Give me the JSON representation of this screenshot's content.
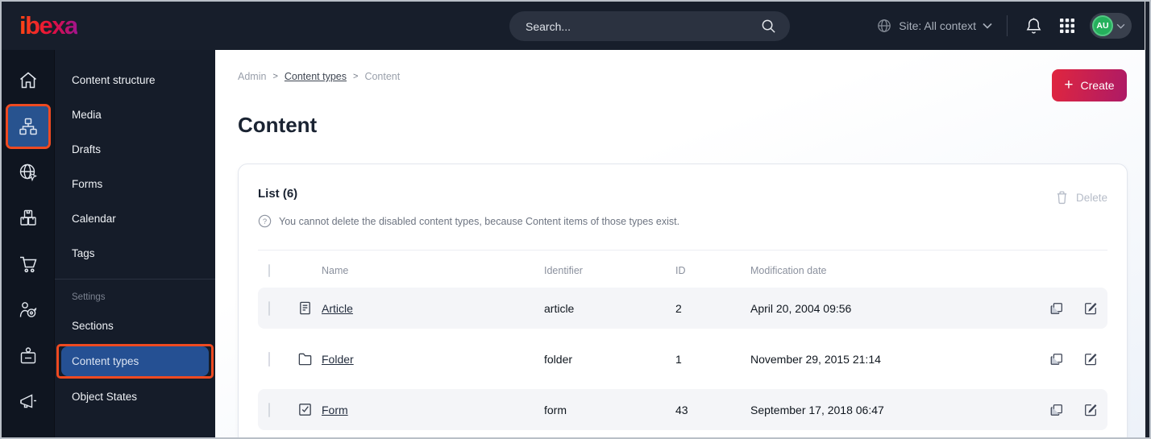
{
  "topbar": {
    "logo": "ibexa",
    "search_placeholder": "Search...",
    "site_selector": "Site: All context",
    "avatar_initials": "AU",
    "icons": [
      "globe-icon",
      "chevron-down-icon",
      "bell-icon",
      "apps-grid-icon",
      "magnifier-icon"
    ]
  },
  "rail": {
    "icons": [
      "home-icon",
      "sitemap-icon",
      "globe-cursor-icon",
      "packages-icon",
      "cart-icon",
      "customer-target-icon",
      "badge-icon",
      "megaphone-icon"
    ],
    "active_index": 1,
    "highlight_color": "#ee4a21",
    "active_bg": "#28538f"
  },
  "sidebar": {
    "items": [
      "Content structure",
      "Media",
      "Drafts",
      "Forms",
      "Calendar",
      "Tags"
    ],
    "settings_label": "Settings",
    "settings_items": [
      "Sections",
      "Content types",
      "Object States"
    ],
    "active_item": "Content types"
  },
  "breadcrumb": {
    "items": [
      "Admin",
      "Content types",
      "Content"
    ],
    "separator": ">"
  },
  "page": {
    "title": "Content",
    "create_label": "Create",
    "create_gradient": [
      "#e0263f",
      "#ad1a66"
    ]
  },
  "card": {
    "title": "List (6)",
    "info_text": "You cannot delete the disabled content types, because Content items of those types exist.",
    "delete_label": "Delete"
  },
  "table": {
    "headers": {
      "name": "Name",
      "identifier": "Identifier",
      "id": "ID",
      "modification_date": "Modification date"
    },
    "rows": [
      {
        "icon": "article-icon",
        "name": "Article",
        "identifier": "article",
        "id": "2",
        "date": "April 20, 2004 09:56",
        "checkbox_disabled": false
      },
      {
        "icon": "folder-icon",
        "name": "Folder",
        "identifier": "folder",
        "id": "1",
        "date": "November 29, 2015 21:14",
        "checkbox_disabled": true
      },
      {
        "icon": "form-icon",
        "name": "Form",
        "identifier": "form",
        "id": "43",
        "date": "September 17, 2018 06:47",
        "checkbox_disabled": false
      }
    ],
    "row_actions": [
      "copy-icon",
      "edit-icon"
    ]
  }
}
